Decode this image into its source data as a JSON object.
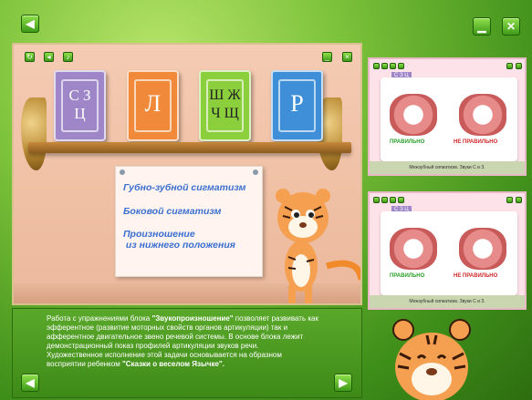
{
  "window": {
    "back_icon": "arrow-left-icon",
    "minimize_icon": "minimize-icon",
    "close_icon": "close-icon"
  },
  "books": [
    {
      "label": "С З\nЦ",
      "color": "#9e86c8"
    },
    {
      "label": "Л",
      "color": "#f08a3a"
    },
    {
      "label": "Ш Ж\nЧ Щ",
      "color": "#8ccf3c"
    },
    {
      "label": "Р",
      "color": "#3e8fd8"
    }
  ],
  "menu": {
    "items": [
      "Губно-зубной сигматизм",
      "Боковой сигматизм",
      "Произношение\n из нижнего положения"
    ]
  },
  "description": {
    "p1_pre": "Работа с упражнениями блока ",
    "p1_bold": "\"Звукопроизношение\"",
    "p1_post": " позволяет развивать как эфферентное (развитие моторных свойств органов артикуляции) так и афферентное двигательное звено речевой системы. В основе блока лежит демонстрационный показ профилей артикуляции звуков речи.",
    "p2_pre": "Художественное исполнение этой задачи основывается на образном восприятии ребенком ",
    "p2_bold": "\"Сказки о веселом Язычке\"."
  },
  "thumbnails": [
    {
      "tab": "С З Ц",
      "correct": "ПРАВИЛЬНО",
      "wrong": "НЕ ПРАВИЛЬНО",
      "caption": "Межзубный сигматизм. Звуки С и З."
    },
    {
      "tab": "С З Ц",
      "correct": "ПРАВИЛЬНО",
      "wrong": "НЕ ПРАВИЛЬНО",
      "caption": "Межзубный сигматизм. Звуки С и З."
    }
  ],
  "colors": {
    "accent_green": "#3f9a18",
    "menu_text": "#3a6fd0",
    "correct": "#2aa02a",
    "wrong": "#d02a2a"
  }
}
